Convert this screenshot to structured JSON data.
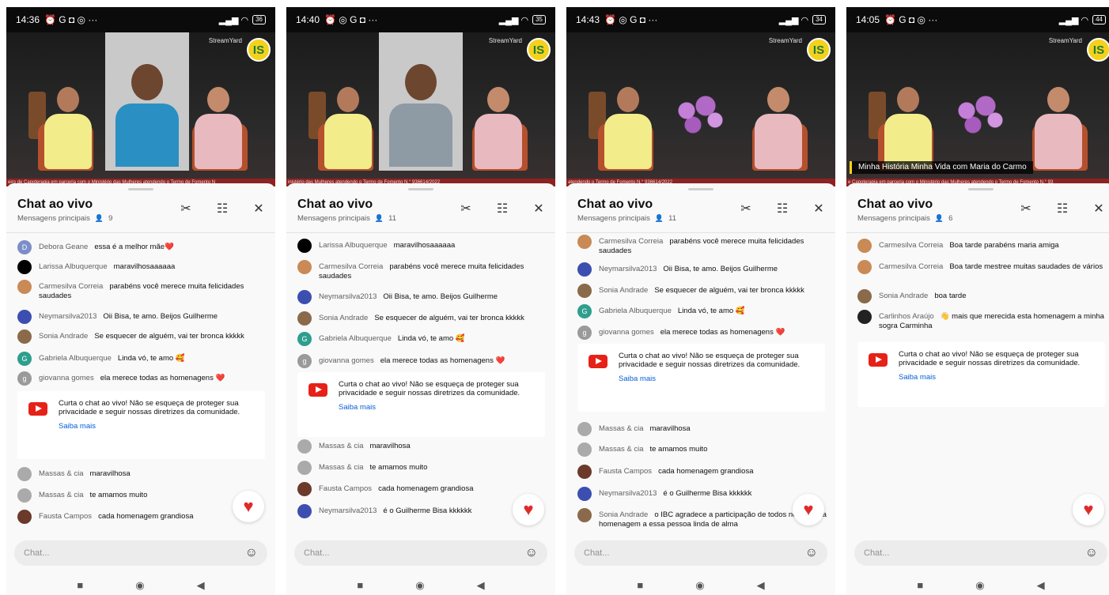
{
  "panels": [
    {
      "status": {
        "time": "14:36",
        "icons": "⏰ G ◘ ◎ ···",
        "battery": "36"
      },
      "video": {
        "ticker": "eiro de Capoterapia em parceria com o Ministério das Mulheres atendendo o Termo de Fomento N",
        "lower_third": "",
        "insert": "woman-and-man"
      },
      "chat": {
        "title": "Chat ao vivo",
        "subtitle": "Mensagens principais",
        "viewers": "9"
      },
      "messages": [
        {
          "author": "Debora Geane",
          "text": "essa é a melhor mãe❤️",
          "avatar": "D",
          "color": "#7b8ec8"
        },
        {
          "author": "Larissa Albuquerque",
          "text": "maravilhosaaaaaa",
          "avatar": "",
          "color": "#000000"
        },
        {
          "author": "Carmesilva Correia",
          "text": "parabéns você merece muita felicidades saudades",
          "avatar": "",
          "color": "#c98a55"
        },
        {
          "author": "Neymarsilva2013",
          "text": "Oii Bisa, te amo. Beijos Guilherme",
          "avatar": "",
          "color": "#3c4fb0"
        },
        {
          "author": "Sonia Andrade",
          "text": "Se esquecer de alguém, vai ter bronca kkkkk",
          "avatar": "",
          "color": "#8a6a4a"
        },
        {
          "author": "Gabriela Albuquerque",
          "text": "Linda vó, te amo 🥰",
          "avatar": "G",
          "color": "#2e9e8e"
        },
        {
          "author": "giovanna gomes",
          "text": "ela merece todas as homenagens ❤️",
          "avatar": "g",
          "color": "#9a9a9a"
        },
        {
          "author": "Massas & cia",
          "text": "maravilhosa",
          "avatar": "",
          "color": "#aaaaaa"
        },
        {
          "author": "Massas & cia",
          "text": "te amamos muito",
          "avatar": "",
          "color": "#aaaaaa"
        },
        {
          "author": "Fausta Campos",
          "text": "cada homenagem grandiosa",
          "avatar": "",
          "color": "#6b3a2a"
        }
      ]
    },
    {
      "status": {
        "time": "14:40",
        "icons": "⏰ ◎ G ◘ ···",
        "battery": "35"
      },
      "video": {
        "ticker": "inistério das Mulheres atendendo o Termo de Fomento N.° 936614/2022",
        "lower_third": "",
        "insert": "boy"
      },
      "chat": {
        "title": "Chat ao vivo",
        "subtitle": "Mensagens principais",
        "viewers": "11"
      },
      "messages": [
        {
          "author": "Larissa Albuquerque",
          "text": "maravilhosaaaaaa",
          "avatar": "",
          "color": "#000000"
        },
        {
          "author": "Carmesilva Correia",
          "text": "parabéns você merece muita felicidades saudades",
          "avatar": "",
          "color": "#c98a55"
        },
        {
          "author": "Neymarsilva2013",
          "text": "Oii Bisa, te amo. Beijos Guilherme",
          "avatar": "",
          "color": "#3c4fb0"
        },
        {
          "author": "Sonia Andrade",
          "text": "Se esquecer de alguém, vai ter bronca kkkkk",
          "avatar": "",
          "color": "#8a6a4a"
        },
        {
          "author": "Gabriela Albuquerque",
          "text": "Linda vó, te amo 🥰",
          "avatar": "G",
          "color": "#2e9e8e"
        },
        {
          "author": "giovanna gomes",
          "text": "ela merece todas as homenagens ❤️",
          "avatar": "g",
          "color": "#9a9a9a"
        },
        {
          "author": "Massas & cia",
          "text": "maravilhosa",
          "avatar": "",
          "color": "#aaaaaa"
        },
        {
          "author": "Massas & cia",
          "text": "te amamos muito",
          "avatar": "",
          "color": "#aaaaaa"
        },
        {
          "author": "Fausta Campos",
          "text": "cada homenagem grandiosa",
          "avatar": "",
          "color": "#6b3a2a"
        },
        {
          "author": "Neymarsilva2013",
          "text": "é o Guilherme Bisa kkkkkk",
          "avatar": "",
          "color": "#3c4fb0"
        }
      ]
    },
    {
      "status": {
        "time": "14:43",
        "icons": "⏰ ◎ G ◘ ···",
        "battery": "34"
      },
      "video": {
        "ticker": "atendendo o Termo de Fomento N.° 936614/2022",
        "lower_third": "",
        "insert": ""
      },
      "chat": {
        "title": "Chat ao vivo",
        "subtitle": "Mensagens principais",
        "viewers": "11"
      },
      "messages": [
        {
          "author": "Carmesilva Correia",
          "text": "parabéns você merece muita felicidades saudades",
          "avatar": "",
          "color": "#c98a55"
        },
        {
          "author": "Neymarsilva2013",
          "text": "Oii Bisa, te amo. Beijos Guilherme",
          "avatar": "",
          "color": "#3c4fb0"
        },
        {
          "author": "Sonia Andrade",
          "text": "Se esquecer de alguém, vai ter bronca kkkkk",
          "avatar": "",
          "color": "#8a6a4a"
        },
        {
          "author": "Gabriela Albuquerque",
          "text": "Linda vó, te amo 🥰",
          "avatar": "G",
          "color": "#2e9e8e"
        },
        {
          "author": "giovanna gomes",
          "text": "ela merece todas as homenagens ❤️",
          "avatar": "g",
          "color": "#9a9a9a"
        },
        {
          "author": "Massas & cia",
          "text": "maravilhosa",
          "avatar": "",
          "color": "#aaaaaa"
        },
        {
          "author": "Massas & cia",
          "text": "te amamos muito",
          "avatar": "",
          "color": "#aaaaaa"
        },
        {
          "author": "Fausta Campos",
          "text": "cada homenagem grandiosa",
          "avatar": "",
          "color": "#6b3a2a"
        },
        {
          "author": "Neymarsilva2013",
          "text": "é o Guilherme Bisa kkkkkk",
          "avatar": "",
          "color": "#3c4fb0"
        },
        {
          "author": "Sonia Andrade",
          "text": "o IBC agradece a participação de todos nessa linda homenagem a essa pessoa linda de alma",
          "avatar": "",
          "color": "#8a6a4a"
        }
      ]
    },
    {
      "status": {
        "time": "14:05",
        "icons": "⏰ G ◘ ◎ ···",
        "battery": "44"
      },
      "video": {
        "ticker": "e Capoterapia em parceria com o Ministério das Mulheres atendendo o Termo de Fomento N.° 93",
        "lower_third": "Minha História Minha Vida com Maria do Carmo",
        "insert": ""
      },
      "chat": {
        "title": "Chat ao vivo",
        "subtitle": "Mensagens principais",
        "viewers": "6"
      },
      "messages": [
        {
          "author": "Carmesilva Correia",
          "text": "Boa tarde parabéns maria amiga",
          "avatar": "",
          "color": "#c98a55"
        },
        {
          "author": "Carmesilva Correia",
          "text": "Boa tarde mestree muitas saudades de vários",
          "avatar": "",
          "color": "#c98a55"
        },
        {
          "author": "Sonia Andrade",
          "text": "boa tarde",
          "avatar": "",
          "color": "#8a6a4a"
        },
        {
          "author": "Carlinhos Araújo",
          "text": "👋 mais que merecida esta homenagem a minha sogra Carminha",
          "avatar": "",
          "color": "#222222"
        }
      ]
    }
  ],
  "notice": {
    "text": "Curta o chat ao vivo! Não se esqueça de proteger sua privacidade e seguir nossas diretrizes da comunidade.",
    "link": "Saiba mais"
  },
  "input": {
    "placeholder": "Chat..."
  },
  "branding": {
    "streamyard": "StreamYard",
    "logo": "IS"
  },
  "icons": {
    "cut": "scissors-icon",
    "filter": "sliders-icon",
    "close": "close-icon",
    "heart": "heart-icon",
    "emoji": "emoji-icon",
    "viewers": "person-icon",
    "nav": [
      "square-icon",
      "circle-icon",
      "back-icon"
    ]
  },
  "colors": {
    "link": "#065fd4",
    "heart": "#e02a2a",
    "youtube": "#e62117",
    "ticker": "#8d2222",
    "logo_bg": "#f4d11c"
  }
}
